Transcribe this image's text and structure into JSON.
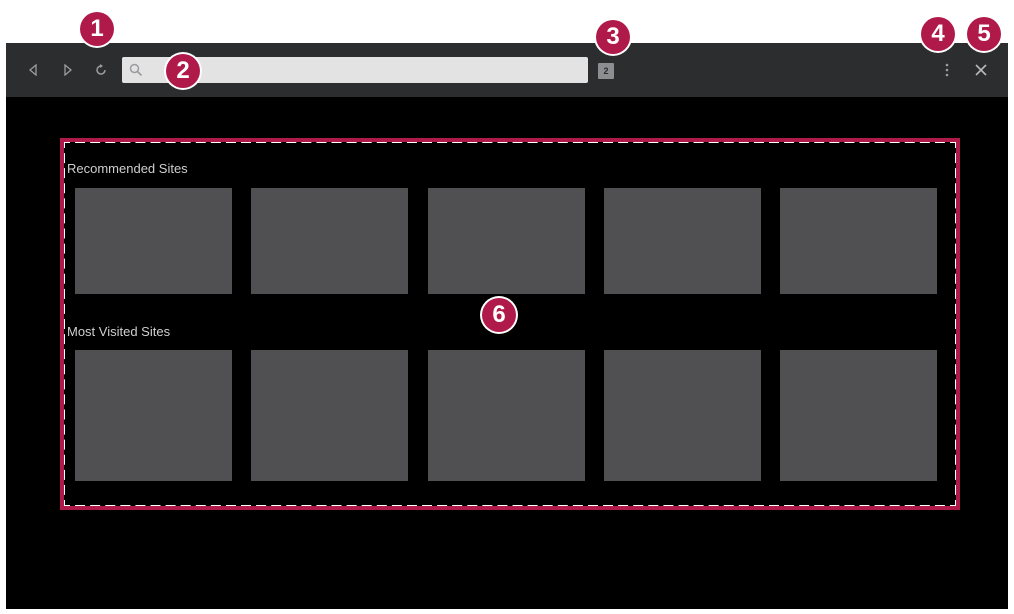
{
  "toolbar": {
    "back_icon": "back-icon",
    "forward_icon": "forward-icon",
    "refresh_icon": "refresh-icon",
    "search_icon": "search-icon",
    "url_value": "",
    "tab_count": "2",
    "menu_icon": "more-vertical-icon",
    "close_icon": "close-icon"
  },
  "content": {
    "recommended_title": "Recommended Sites",
    "recommended_tiles": [
      "",
      "",
      "",
      "",
      ""
    ],
    "most_visited_title": "Most Visited Sites",
    "most_visited_tiles": [
      "",
      "",
      "",
      "",
      ""
    ]
  },
  "callouts": [
    "1",
    "2",
    "3",
    "4",
    "5",
    "6"
  ],
  "colors": {
    "toolbar_bg": "#2c2d2f",
    "page_bg": "#000000",
    "tile_bg": "#505052",
    "callout_bg": "#b01a4b",
    "frame_dash": "#ffffff",
    "url_bar_bg": "#e3e3e3"
  }
}
